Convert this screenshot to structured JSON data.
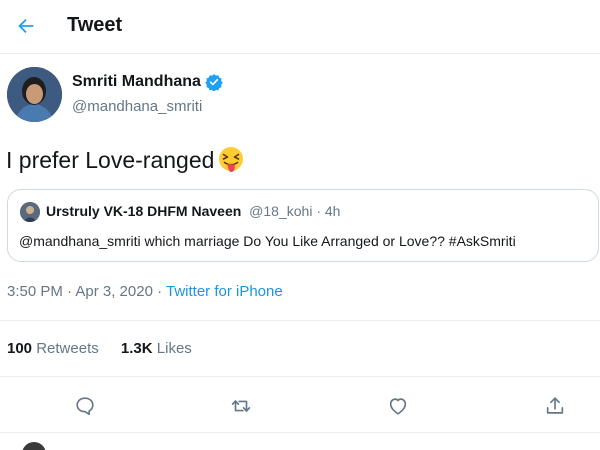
{
  "header": {
    "title": "Tweet"
  },
  "tweet": {
    "author": {
      "display_name": "Smriti Mandhana",
      "handle": "@mandhana_smriti",
      "verified": true
    },
    "text": "I prefer Love-ranged",
    "emoji": "squinting-face-with-tongue",
    "timestamp": "3:50 PM · Apr 3, 2020 · ",
    "source": "Twitter for iPhone",
    "stats": {
      "retweets_count": "100",
      "retweets_label": "Retweets",
      "likes_count": "1.3K",
      "likes_label": "Likes"
    }
  },
  "quote": {
    "display_name": "Urstruly VK-18 DHFM Naveen",
    "handle_time": "@18_kohi · 4h",
    "text": "@mandhana_smriti which marriage Do You Like Arranged or Love?? #AskSmriti"
  },
  "colors": {
    "accent": "#1da1f2",
    "text": "#14171a",
    "muted": "#657786",
    "border": "#ebeef0"
  },
  "icons": [
    "back-arrow-icon",
    "verified-badge-icon",
    "reply-icon",
    "retweet-icon",
    "like-icon",
    "share-icon"
  ]
}
